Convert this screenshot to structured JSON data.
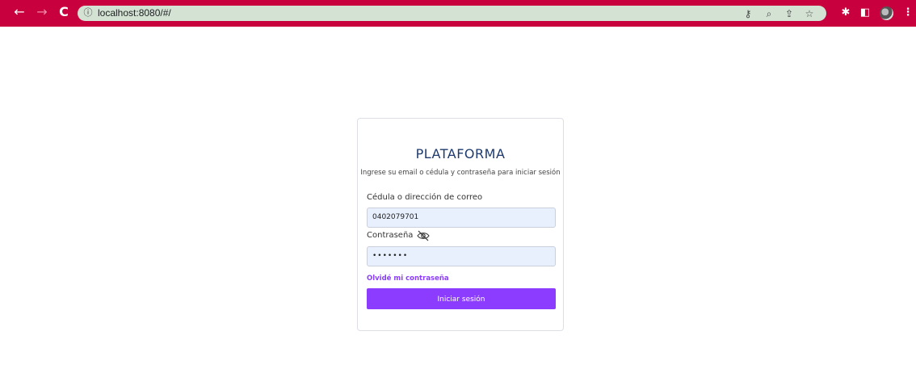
{
  "browser": {
    "url": "localhost:8080/#/",
    "icons": {
      "back": "back-arrow-icon",
      "forward": "forward-arrow-icon",
      "reload": "reload-icon",
      "info": "info-icon",
      "key": "key-icon",
      "zoom": "zoom-icon",
      "share": "share-icon",
      "bookmark": "star-icon",
      "extensions": "puzzle-icon",
      "sidepanel": "side-panel-icon",
      "menu": "kebab-menu-icon"
    },
    "colors": {
      "frame": "#c9003e",
      "omnibox": "#d4e2d4"
    }
  },
  "login": {
    "title": "PLATAFORMA",
    "subtitle": "Ingrese su email o cédula y contraseña para iniciar sesión",
    "user_label": "Cédula o dirección de correo",
    "user_value": "0402079701",
    "password_label": "Contraseña",
    "password_value": "•••••••",
    "forgot_link": "Olvidé mi contraseña",
    "submit_label": "Iniciar sesión",
    "colors": {
      "title": "#1e3a6e",
      "accent": "#8c3cff",
      "input_bg": "#e8f0fe"
    }
  }
}
